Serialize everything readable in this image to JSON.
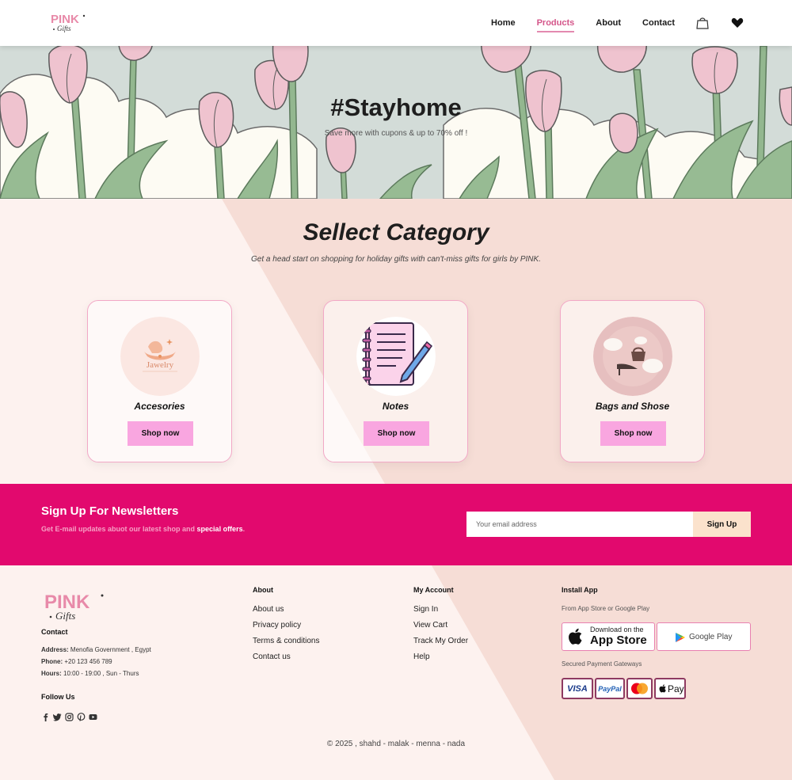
{
  "header": {
    "logo_text": "PINK Gifts",
    "nav": [
      {
        "label": "Home"
      },
      {
        "label": "Products",
        "active": true
      },
      {
        "label": "About"
      },
      {
        "label": "Contact"
      }
    ],
    "icons": [
      "shopping-bag-icon",
      "heart-icon"
    ]
  },
  "hero": {
    "title": "#Stayhome",
    "subtitle": "Save more with cupons & up to 70% off !"
  },
  "categories": {
    "title": "Sellect Category",
    "subtitle": "Get a head start on shopping for holiday gifts with can't-miss gifts for girls by PINK.",
    "items": [
      {
        "name": "Accesories",
        "button": "Shop now",
        "image_text": "Jawelry"
      },
      {
        "name": "Notes",
        "button": "Shop now"
      },
      {
        "name": "Bags and Shose",
        "button": "Shop now"
      }
    ]
  },
  "newsletter": {
    "title": "Sign Up For Newsletters",
    "desc_part1": "Get E-mail updates abuot our latest shop and",
    "desc_highlight": "special offers",
    "desc_end": ".",
    "placeholder": "Your email address",
    "button": "Sign Up"
  },
  "footer": {
    "logo_text": "PINK Gifts",
    "contact": {
      "heading": "Contact",
      "address_label": "Address:",
      "address": "Menofia Government , Egypt",
      "phone_label": "Phone:",
      "phone": "+20 123 456 789",
      "hours_label": "Hours:",
      "hours": "10:00 - 19:00 , Sun - Thurs"
    },
    "follow": {
      "heading": "Follow Us",
      "icons": [
        "facebook-icon",
        "twitter-icon",
        "instagram-icon",
        "pinterest-icon",
        "youtube-icon"
      ]
    },
    "about": {
      "heading": "About",
      "links": [
        "About us",
        "Privacy policy",
        "Terms & conditions",
        "Contact us"
      ]
    },
    "account": {
      "heading": "My Account",
      "links": [
        "Sign In",
        "View Cart",
        "Track My Order",
        "Help"
      ]
    },
    "install": {
      "heading": "Install App",
      "subtitle": "From App Store or Google Play",
      "appstore_small": "Download on the",
      "appstore_big": "App Store",
      "googleplay": "Google Play",
      "payment_label": "Secured Payment Gateways",
      "payments": [
        "VISA",
        "PayPal",
        "mastercard",
        "Pay"
      ]
    },
    "copyright": "© 2025 , shahd - malak - menna - nada"
  },
  "colors": {
    "accent_pink": "#e2096e",
    "button_pink": "#f9a6e0",
    "nav_active": "#d4568a",
    "peach": "#f6ddd6"
  }
}
